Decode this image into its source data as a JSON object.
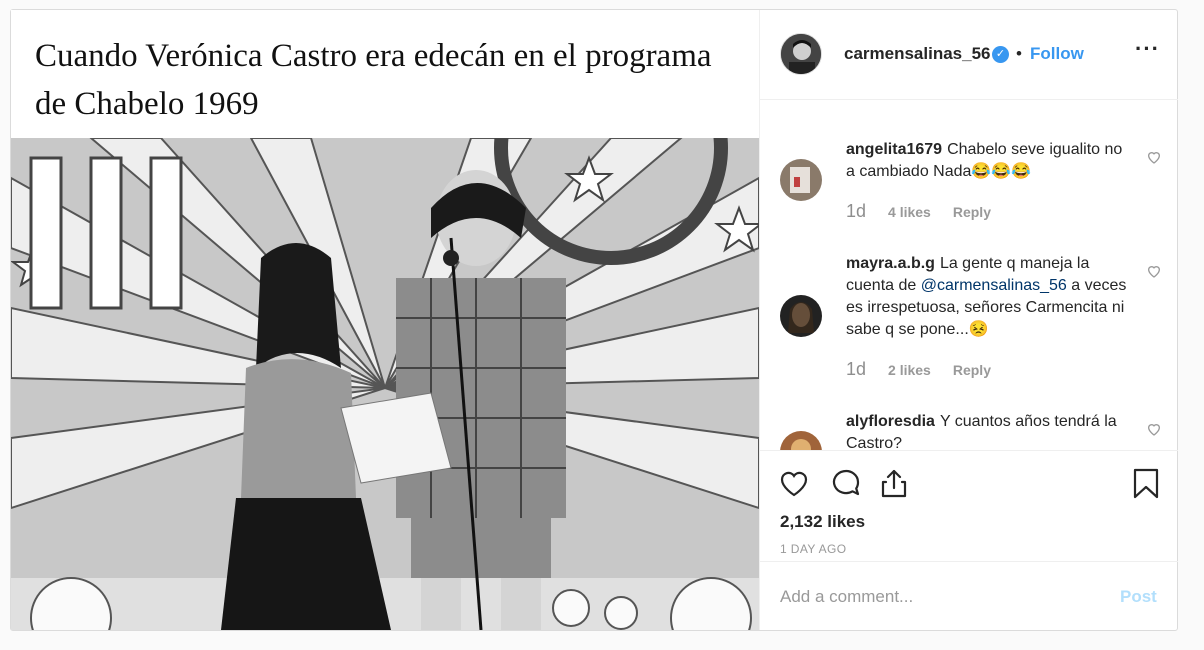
{
  "post": {
    "caption": "Cuando Verónica Castro era edecán en el programa de Chabelo 1969",
    "image_icon": "black-and-white-photo"
  },
  "header": {
    "username": "carmensalinas_56",
    "verified_icon": "verified-badge-icon",
    "separator": "•",
    "follow_label": "Follow",
    "more_label": "···"
  },
  "comments": [
    {
      "username": "angelita1679",
      "text": "Chabelo seve igualito no a cambiado Nada😂😂😂",
      "time": "1d",
      "likes": "4 likes",
      "reply": "Reply"
    },
    {
      "username": "mayra.a.b.g",
      "text_before": "La gente q maneja la cuenta de ",
      "mention": "@carmensalinas_56",
      "text_after": " a veces es irrespetuosa, señores Carmencita ni sabe q se pone...😣",
      "time": "1d",
      "likes": "2 likes",
      "reply": "Reply"
    },
    {
      "username": "alyfloresdia",
      "text": "Y cuantos años tendrá la Castro?"
    }
  ],
  "actions": {
    "likes": "2,132 likes",
    "date": "1 DAY AGO"
  },
  "add_comment": {
    "placeholder": "Add a comment...",
    "post_label": "Post"
  },
  "colors": {
    "accent": "#3897f0",
    "post_disabled": "#b2dffc",
    "muted": "#999999"
  }
}
